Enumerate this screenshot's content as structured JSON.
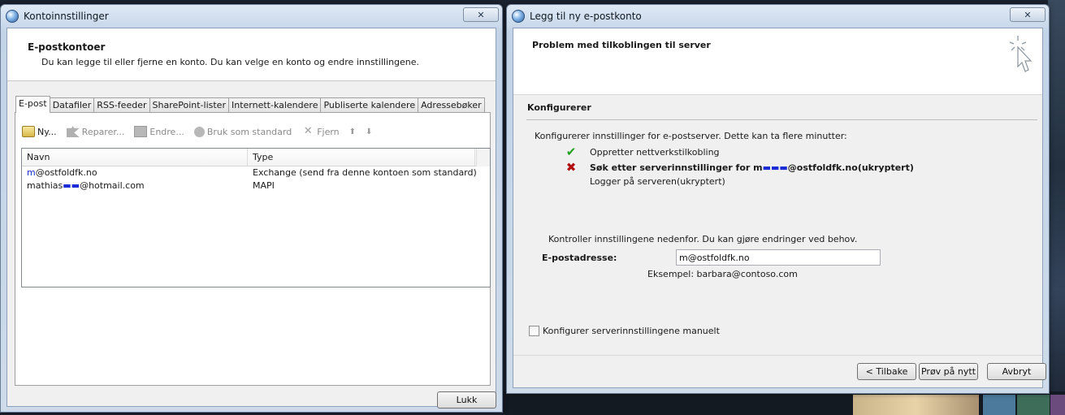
{
  "account_settings": {
    "window_title": "Kontoinnstillinger",
    "close_glyph": "✕",
    "header_title": "E-postkontoer",
    "header_subtitle": "Du kan legge til eller fjerne en konto. Du kan velge en konto og endre innstillingene.",
    "tabs": [
      "E-post",
      "Datafiler",
      "RSS-feeder",
      "SharePoint-lister",
      "Internett-kalendere",
      "Publiserte kalendere",
      "Adressebøker"
    ],
    "active_tab": "E-post",
    "toolbar": {
      "new": "Ny...",
      "repair": "Reparer...",
      "change": "Endre...",
      "set_default": "Bruk som standard",
      "remove": "Fjern",
      "move_up_glyph": "⬆",
      "move_down_glyph": "⬇"
    },
    "table": {
      "columns": [
        "Navn",
        "Type"
      ],
      "rows": [
        {
          "name_prefix": "m",
          "name_suffix": "@ostfoldfk.no",
          "type": "Exchange (send fra denne kontoen som standard)"
        },
        {
          "name_prefix": "mathias",
          "name_suffix": "@hotmail.com",
          "type": "MAPI"
        }
      ]
    },
    "close_button": "Lukk"
  },
  "add_account": {
    "window_title": "Legg til ny e-postkonto",
    "close_glyph": "✕",
    "header_title": "Problem med tilkoblingen til server",
    "section_title": "Konfigurerer",
    "description": "Konfigurerer innstillinger for e-postserver. Dette kan ta flere minutter:",
    "steps": [
      {
        "status": "ok",
        "glyph": "✔",
        "label": "Oppretter nettverkstilkobling"
      },
      {
        "status": "failed",
        "glyph": "✖",
        "label": "Søk etter serverinnstillinger for m",
        "label_suffix": "@ostfoldfk.no(ukryptert)"
      },
      {
        "status": "pending",
        "glyph": "",
        "label": "Logger på serveren(ukryptert)"
      }
    ],
    "hint": "Kontroller innstillingene nedenfor. Du kan gjøre endringer ved behov.",
    "email_label": "E-postadresse:",
    "email_value": "m@ostfoldfk.no",
    "example": "Eksempel: barbara@contoso.com",
    "manual_config_label": "Konfigurer serverinnstillingene manuelt",
    "manual_config_checked": false,
    "buttons": {
      "back": "< Tilbake",
      "retry": "Prøv på nytt",
      "cancel": "Avbryt"
    }
  },
  "colors": {
    "window_frame": "#c2d3e7",
    "client_bg": "#f0f0f0",
    "ok_mark": "#1fa21f",
    "fail_mark": "#b10f0f",
    "scribble": "#1b2bd6"
  }
}
